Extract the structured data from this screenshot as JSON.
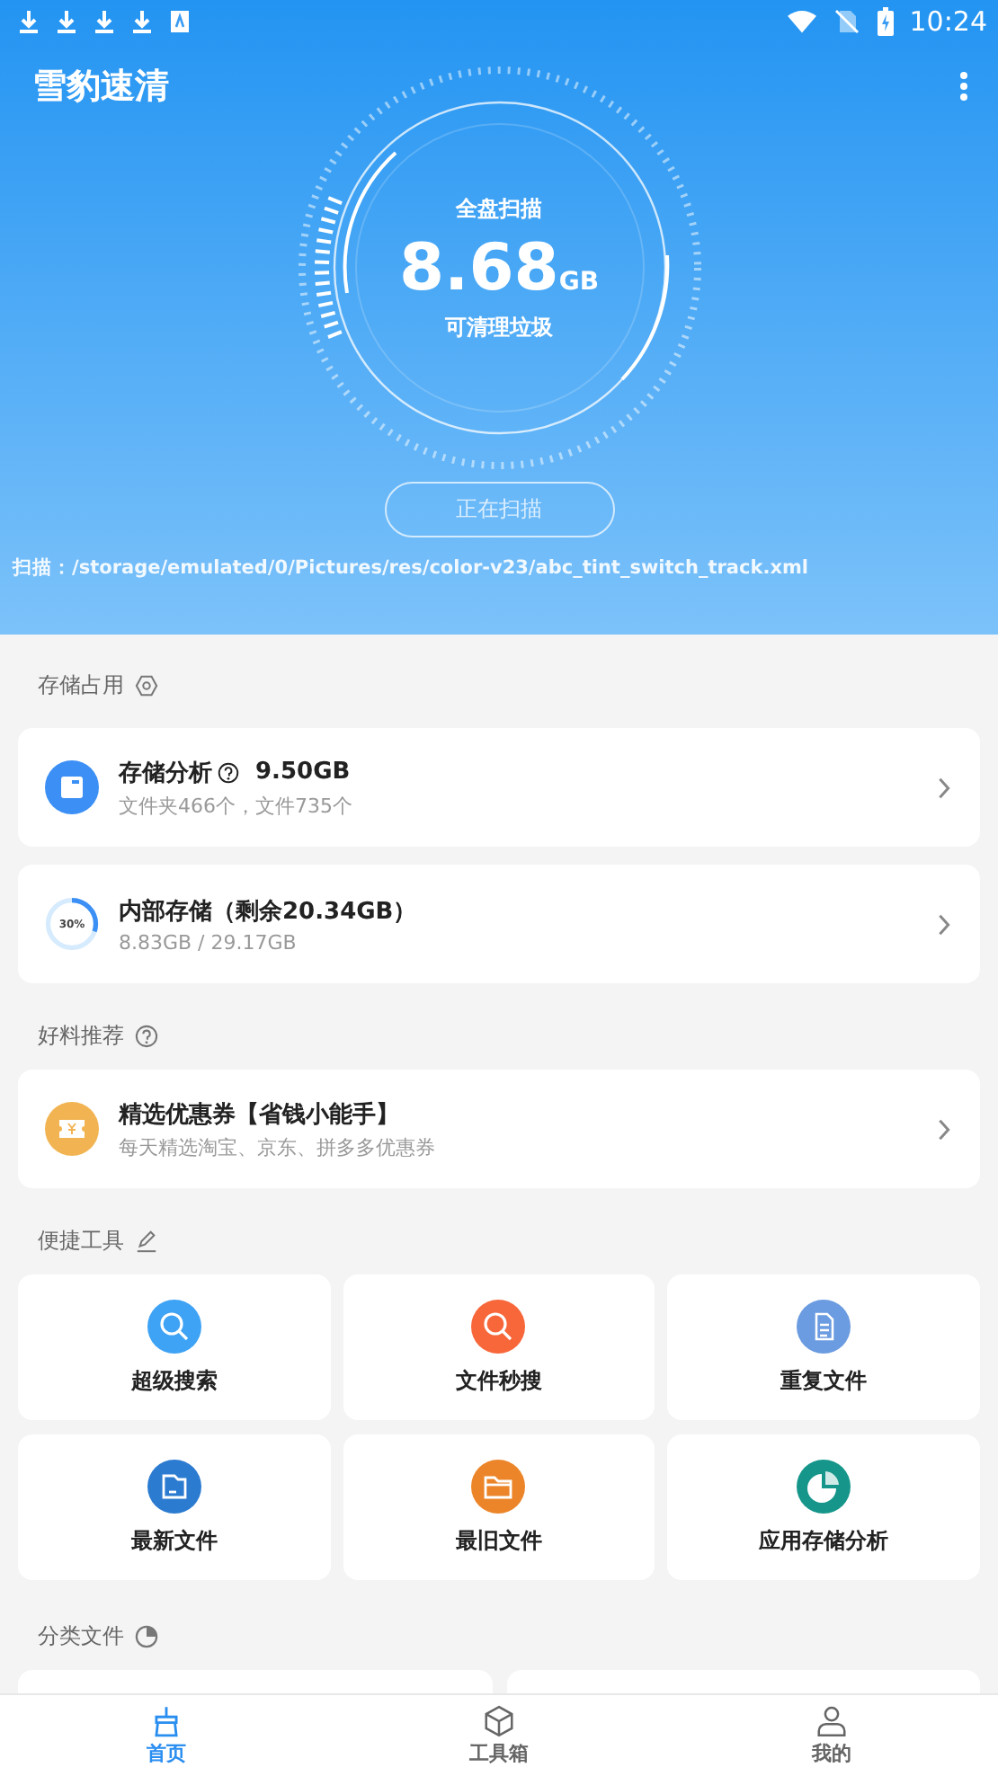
{
  "status_bar": {
    "time": "10:24"
  },
  "app_bar": {
    "title": "雪豹速清"
  },
  "scan": {
    "caption": "全盘扫描",
    "amount": "8.68",
    "unit": "GB",
    "subtitle": "可清理垃圾",
    "button": "正在扫描",
    "path": "扫描：/storage/emulated/0/Pictures/res/color-v23/abc_tint_switch_track.xml"
  },
  "storage_section": {
    "title": "存储占用"
  },
  "storage_analysis": {
    "title": "存储分析",
    "size": "9.50GB",
    "detail": "文件夹466个，文件735个"
  },
  "internal_storage": {
    "title": "内部存储（剩余20.34GB）",
    "detail": "8.83GB / 29.17GB",
    "percent": "30%",
    "level": 0.3
  },
  "recommend_section": {
    "title": "好料推荐"
  },
  "coupon": {
    "title": "精选优惠券【省钱小能手】",
    "detail": "每天精选淘宝、京东、拼多多优惠券"
  },
  "tools_section": {
    "title": "便捷工具"
  },
  "tools": [
    {
      "label": "超级搜索",
      "color": "#3ea2f5"
    },
    {
      "label": "文件秒搜",
      "color": "#f7673a"
    },
    {
      "label": "重复文件",
      "color": "#6b9be0"
    },
    {
      "label": "最新文件",
      "color": "#2b7bd0"
    },
    {
      "label": "最旧文件",
      "color": "#ec8529"
    },
    {
      "label": "应用存储分析",
      "color": "#16968a"
    }
  ],
  "category_section": {
    "title": "分类文件"
  },
  "bottom_nav": [
    {
      "label": "首页",
      "selected": true
    },
    {
      "label": "工具箱",
      "selected": false
    },
    {
      "label": "我的",
      "selected": false
    }
  ]
}
